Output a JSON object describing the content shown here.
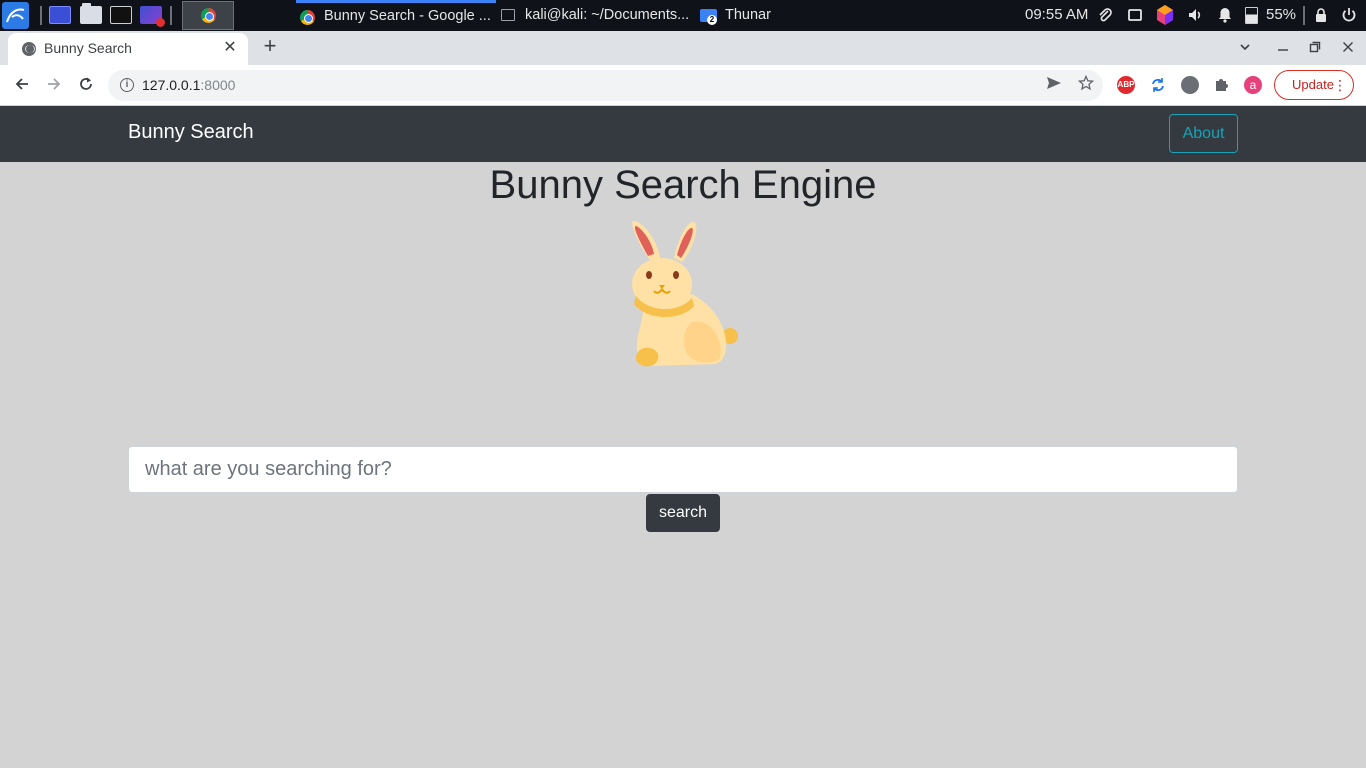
{
  "taskbar": {
    "tasks": [
      {
        "label": "Bunny Search - Google ..."
      },
      {
        "label": "kali@kali: ~/Documents..."
      },
      {
        "label": "Thunar",
        "badge": "2"
      }
    ],
    "clock": "09:55 AM",
    "battery": "55%"
  },
  "browser": {
    "tab_title": "Bunny Search",
    "tab_close": "✕",
    "new_tab": "+",
    "url_host": "127.0.0.1",
    "url_port": ":8000",
    "profile_initial": "a",
    "update_label": "Update",
    "extensions": {
      "abp": "ABP"
    }
  },
  "page": {
    "brand": "Bunny Search",
    "about_label": "About",
    "title": "Bunny Search Engine",
    "search_placeholder": "what are you searching for?",
    "search_button": "search"
  },
  "colors": {
    "navbar": "#343a40",
    "page_bg": "#d3d3d3",
    "about_outline": "#17a2b8",
    "bunny_body": "#ffe1a6",
    "bunny_ear_inner": "#e0605a",
    "bunny_scarf": "#f6c04a"
  }
}
